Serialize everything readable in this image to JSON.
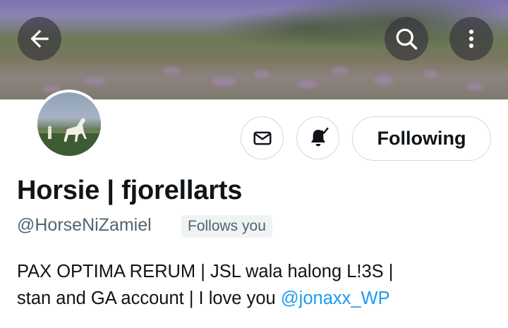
{
  "header": {
    "back_icon": "arrow-left-icon",
    "search_icon": "search-icon",
    "more_icon": "more-vertical-icon"
  },
  "profile": {
    "display_name": "Horsie | fjorellarts",
    "handle": "@HorseNiZamiel",
    "follows_you": "Follows you",
    "bio_line1": "PAX OPTIMA RERUM | JSL wala halong L!3S |",
    "bio_line2": "stan and GA account | I love you ",
    "bio_mention": "@jonaxx_WP"
  },
  "actions": {
    "message_icon": "envelope-icon",
    "notifications_icon": "bell-check-icon",
    "follow_label": "Following"
  },
  "colors": {
    "text": "#0f1419",
    "secondary": "#536471",
    "link": "#1d9bf0",
    "border": "#cfd9de",
    "badge_bg": "#eff3f4"
  }
}
